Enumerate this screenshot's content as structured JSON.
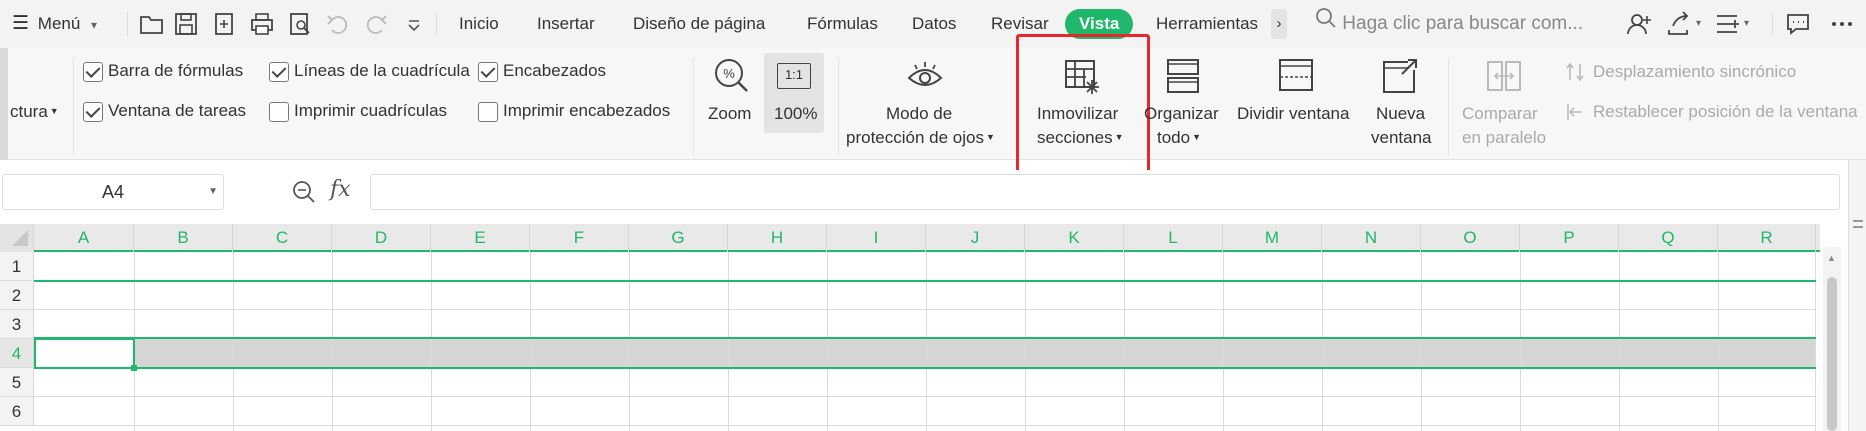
{
  "menubar": {
    "menu_label": "Menú",
    "tabs": [
      "Inicio",
      "Insertar",
      "Diseño de página",
      "Fórmulas",
      "Datos",
      "Revisar",
      "Vista",
      "Herramientas"
    ],
    "active_tab": "Vista",
    "more_tabs": "›",
    "search_placeholder": "Haga clic para buscar com..."
  },
  "ribbon": {
    "view_partial_label": "ctura",
    "checkboxes": {
      "formula_bar": {
        "label": "Barra de fórmulas",
        "checked": true
      },
      "gridlines": {
        "label": "Líneas de la cuadrícula",
        "checked": true
      },
      "headings": {
        "label": "Encabezados",
        "checked": true
      },
      "task_window": {
        "label": "Ventana de tareas",
        "checked": true
      },
      "print_gridlines": {
        "label": "Imprimir cuadrículas",
        "checked": false
      },
      "print_headings": {
        "label": "Imprimir encabezados",
        "checked": false
      }
    },
    "zoom_label": "Zoom",
    "zoom_100_label": "100%",
    "zoom_100_icon_text": "1:1",
    "eye_mode_line1": "Modo de",
    "eye_mode_line2": "protección de ojos",
    "freeze_line1": "Inmovilizar",
    "freeze_line2": "secciones",
    "arrange_line1": "Organizar",
    "arrange_line2": "todo",
    "split_label": "Dividir ventana",
    "new_window_line1": "Nueva",
    "new_window_line2": "ventana",
    "compare_line1": "Comparar",
    "compare_line2": "en paralelo",
    "sync_scroll": "Desplazamiento sincrónico",
    "reset_position": "Restablecer posición de la ventana"
  },
  "formula_bar": {
    "name_box": "A4",
    "fx_label": "fx",
    "formula_value": ""
  },
  "grid": {
    "columns": [
      "A",
      "B",
      "C",
      "D",
      "E",
      "F",
      "G",
      "H",
      "I",
      "J",
      "K",
      "L",
      "M",
      "N",
      "O",
      "P",
      "Q",
      "R"
    ],
    "rows": [
      "1",
      "2",
      "3",
      "4",
      "5",
      "6"
    ],
    "selected_cell": "A4",
    "selected_row": "4",
    "frozen_rows": 1
  },
  "colors": {
    "accent_green": "#1fb86a",
    "highlight_red": "#e8262c"
  }
}
